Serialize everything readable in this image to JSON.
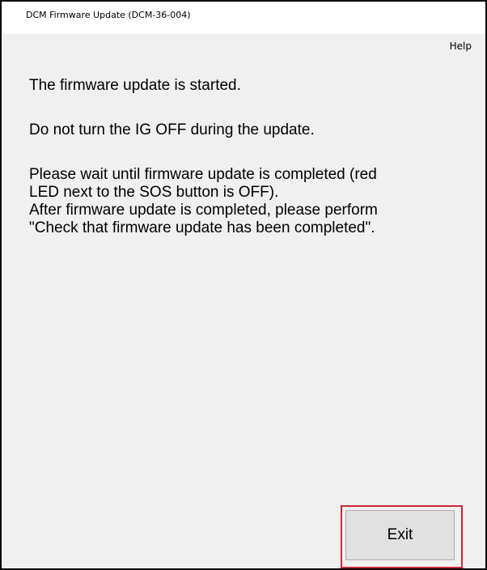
{
  "window": {
    "title": "DCM Firmware Update (DCM-36-004)"
  },
  "menu": {
    "help_label": "Help"
  },
  "message": {
    "line1": "The firmware update is started.",
    "line2": "Do not turn the IG OFF during the update.",
    "line3a": "Please wait until firmware update is completed (red",
    "line3b": "LED next to the SOS button is OFF).",
    "line3c": "After firmware update is completed, please perform",
    "line3d": "\"Check that firmware update has been completed\"."
  },
  "buttons": {
    "exit_label": "Exit"
  },
  "colors": {
    "highlight_border": "#c7283a",
    "dialog_background": "#f0f0f0",
    "button_background": "#e1e1e1"
  }
}
